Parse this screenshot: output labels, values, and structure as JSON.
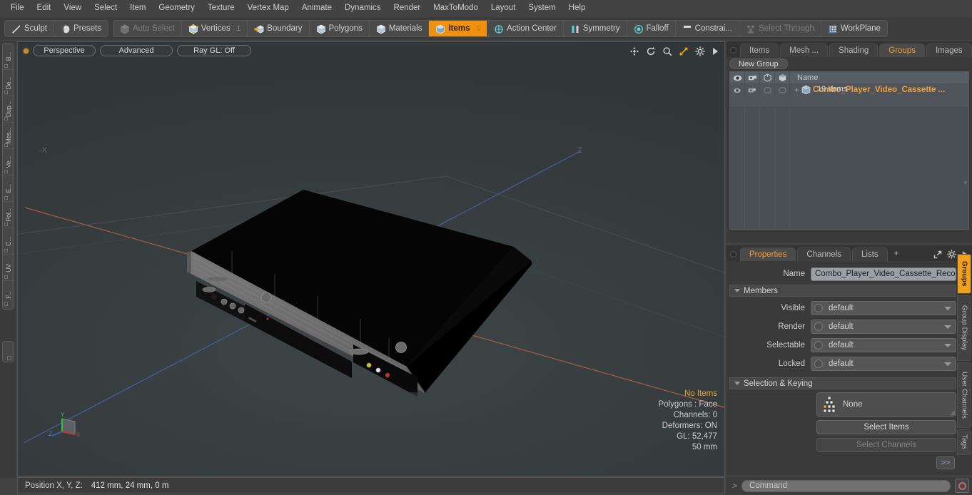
{
  "menu": {
    "items": [
      "File",
      "Edit",
      "View",
      "Select",
      "Item",
      "Geometry",
      "Texture",
      "Vertex Map",
      "Animate",
      "Dynamics",
      "Render",
      "MaxToModo",
      "Layout",
      "System",
      "Help"
    ]
  },
  "toolbar": {
    "groups": [
      {
        "buttons": [
          {
            "label": "Sculpt",
            "icon": "pencil-icon",
            "state": "normal"
          },
          {
            "label": "Presets",
            "icon": "sphere-icon",
            "state": "normal"
          }
        ]
      },
      {
        "buttons": [
          {
            "label": "Auto Select",
            "icon": "cube-icon",
            "state": "dim"
          },
          {
            "label": "Vertices",
            "icon": "cube-vertices-icon",
            "state": "normal",
            "badge": "1"
          },
          {
            "label": "Boundary",
            "icon": "cube-boundary-icon",
            "state": "normal"
          },
          {
            "label": "Polygons",
            "icon": "cube-polygons-icon",
            "state": "normal"
          },
          {
            "label": "Materials",
            "icon": "cube-materials-icon",
            "state": "normal"
          },
          {
            "label": "Items",
            "icon": "cube-items-icon",
            "state": "active",
            "badge": "5"
          },
          {
            "label": "Action Center",
            "icon": "action-center-icon",
            "state": "normal"
          },
          {
            "label": "Symmetry",
            "icon": "symmetry-icon",
            "state": "normal"
          },
          {
            "label": "Falloff",
            "icon": "falloff-icon",
            "state": "normal"
          },
          {
            "label": "Constrai...",
            "icon": "constraint-icon",
            "state": "normal"
          },
          {
            "label": "Select Through",
            "icon": "select-through-icon",
            "state": "dim"
          },
          {
            "label": "WorkPlane",
            "icon": "workplane-icon",
            "state": "normal"
          }
        ]
      }
    ]
  },
  "left_tabs": [
    "B...",
    "De...",
    "Dup...",
    "Mes...",
    "Ve...",
    "E...",
    "Pol...",
    "C...",
    "UV",
    "F..."
  ],
  "viewport": {
    "mode": "Perspective",
    "shading": "Advanced",
    "raygl": "Ray GL: Off",
    "axis_labels": {
      "neg_x": "-X",
      "neg_z": "-Z"
    },
    "gizmo_labels": {
      "x": "X",
      "y": "Y",
      "z": "Z"
    },
    "icons": [
      "pan-icon",
      "rotate-icon",
      "zoom-icon",
      "fit-icon",
      "gear-icon",
      "play-arrow-icon"
    ],
    "hud": [
      "No Items",
      "Polygons : Face",
      "Channels: 0",
      "Deformers: ON",
      "GL: 52,477",
      "50 mm"
    ]
  },
  "statusbar": {
    "label": "Position X, Y, Z:",
    "value": "412 mm, 24 mm, 0 m"
  },
  "groups_panel": {
    "tabs": [
      {
        "label": "Items",
        "selected": false
      },
      {
        "label": "Mesh ...",
        "selected": false
      },
      {
        "label": "Shading",
        "selected": false
      },
      {
        "label": "Groups",
        "selected": true
      },
      {
        "label": "Images",
        "selected": false
      },
      {
        "label": "+",
        "selected": false
      }
    ],
    "new_group_button": "New Group",
    "columns": [
      "visible-eye-icon",
      "render-icon",
      "box-a-icon",
      "box-b-icon"
    ],
    "name_column": "Name",
    "rows": [
      {
        "name": "Combo_Player_Video_Cassette  ...",
        "sub": "19 Items",
        "expander": "+"
      }
    ]
  },
  "properties_panel": {
    "tabs": [
      {
        "label": "Properties",
        "selected": true
      },
      {
        "label": "Channels",
        "selected": false
      },
      {
        "label": "Lists",
        "selected": false
      },
      {
        "label": "+",
        "selected": false
      }
    ],
    "name_label": "Name",
    "name_value": "Combo_Player_Video_Cassette_Recor",
    "members_section": "Members",
    "fields": [
      {
        "label": "Visible",
        "value": "default"
      },
      {
        "label": "Render",
        "value": "default"
      },
      {
        "label": "Selectable",
        "value": "default"
      },
      {
        "label": "Locked",
        "value": "default"
      }
    ],
    "selection_section": "Selection & Keying",
    "selection_value": "None",
    "select_items_button": "Select Items",
    "select_channels_button": "Select Channels",
    "expand_button": ">>"
  },
  "right_tabs": [
    {
      "label": "Groups",
      "selected": true
    },
    {
      "label": "Group Display",
      "selected": false
    },
    {
      "label": "User Channels",
      "selected": false
    },
    {
      "label": "Tags",
      "selected": false
    }
  ],
  "command_bar": {
    "prompt": ">",
    "placeholder": "Command",
    "record_icon": "record-circle-icon"
  },
  "colors": {
    "accent": "#f0a03a",
    "panel": "#3a3a3a",
    "viewport": "#343a3c",
    "highlight": "#f0900f"
  }
}
